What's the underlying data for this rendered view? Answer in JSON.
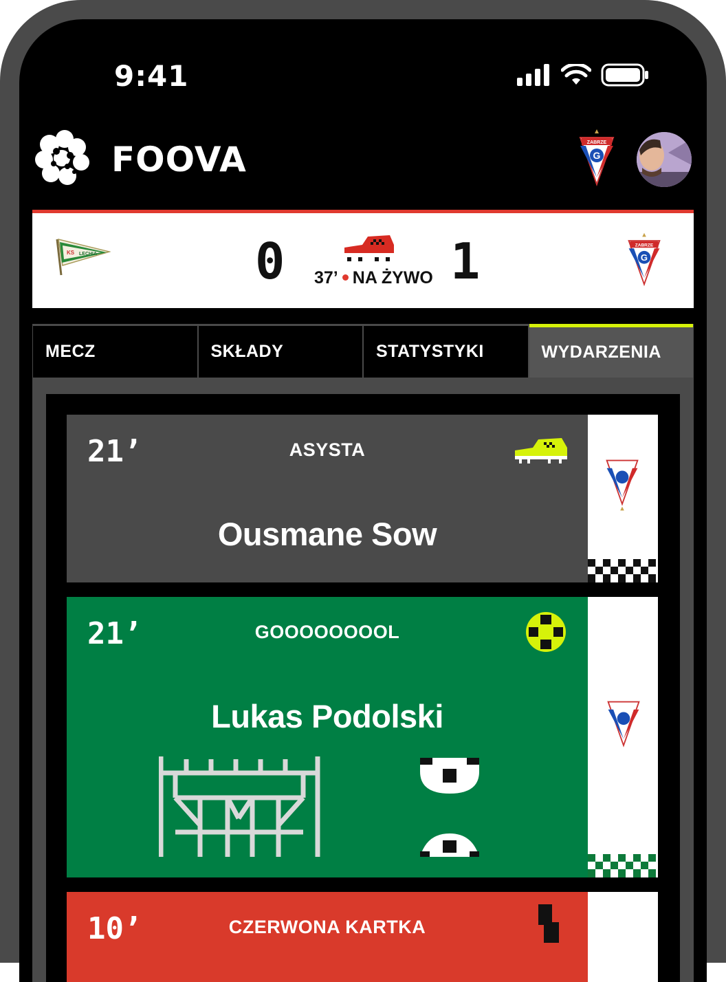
{
  "status_bar": {
    "time": "9:41",
    "icons": [
      "signal-icon",
      "wifi-icon",
      "battery-icon"
    ]
  },
  "header": {
    "brand": "FOOVA",
    "logo_icon": "brain-logo-icon",
    "club_crest": "gornik-zabrze-crest",
    "club_crest_text": "ZABRZE",
    "avatar": "user-avatar"
  },
  "match": {
    "home_team": "LECHIA",
    "home_crest_text": "KS LECHIA",
    "away_crest_text": "ZABRZE",
    "home_score": "0",
    "away_score": "1",
    "minute": "37’",
    "live_label": "NA ŻYWO"
  },
  "tabs": [
    {
      "label": "MECZ",
      "active": false
    },
    {
      "label": "SKŁADY",
      "active": false
    },
    {
      "label": "STATYSTYKI",
      "active": false
    },
    {
      "label": "WYDARZENIA",
      "active": true
    }
  ],
  "events": [
    {
      "minute": "21’",
      "type": "ASYSTA",
      "player": "Ousmane Sow",
      "icon": "boot-icon",
      "bg": "#4a4a4a"
    },
    {
      "minute": "21’",
      "type": "GOOOOOOOOL",
      "player": "Lukas Podolski",
      "icon": "ball-icon",
      "bg": "#007f44"
    },
    {
      "minute": "10’",
      "type": "CZERWONA KARTKA",
      "player": "",
      "icon": "red-card-icon",
      "bg": "#d93a2b"
    }
  ],
  "colors": {
    "accent": "#d6f20a",
    "live": "#e03a2f",
    "goal_green": "#007f44",
    "assist_grey": "#4a4a4a",
    "red_card": "#d93a2b"
  }
}
